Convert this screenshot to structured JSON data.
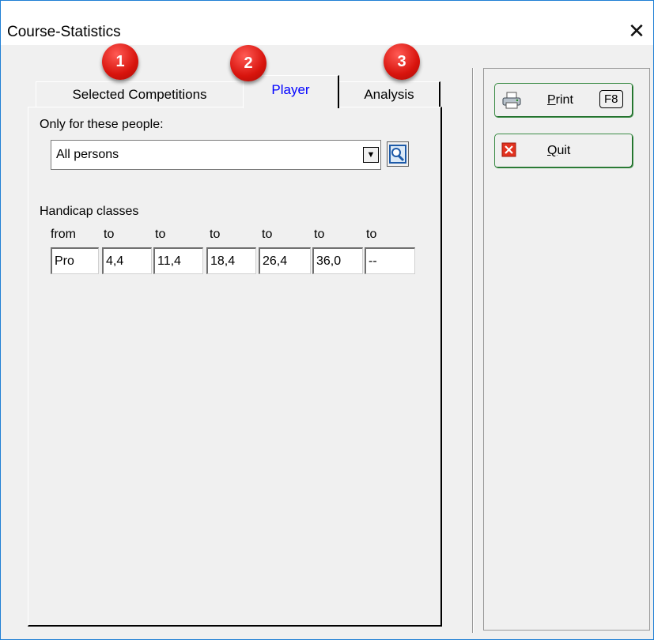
{
  "window": {
    "title": "Course-Statistics",
    "close_glyph": "✕"
  },
  "tabs": [
    {
      "label": "Selected Competitions",
      "badge": "1"
    },
    {
      "label": "Player",
      "badge": "2",
      "active": true
    },
    {
      "label": "Analysis",
      "badge": "3"
    }
  ],
  "player_tab": {
    "people_label": "Only for these people:",
    "people_value": "All persons",
    "handicap_label": "Handicap classes",
    "columns": [
      "from",
      "to",
      "to",
      "to",
      "to",
      "to",
      "to"
    ],
    "values": [
      "Pro",
      "4,4",
      "11,4",
      "18,4",
      "26,4",
      "36,0",
      "--"
    ]
  },
  "buttons": {
    "print": {
      "first": "P",
      "rest": "rint",
      "key": "F8"
    },
    "quit": {
      "first": "Q",
      "rest": "uit"
    }
  },
  "colors": {
    "active_tab": "#0000ff",
    "badge": "#e0201a",
    "button_border": "#3c8c46",
    "window_border": "#1f7fd4"
  }
}
